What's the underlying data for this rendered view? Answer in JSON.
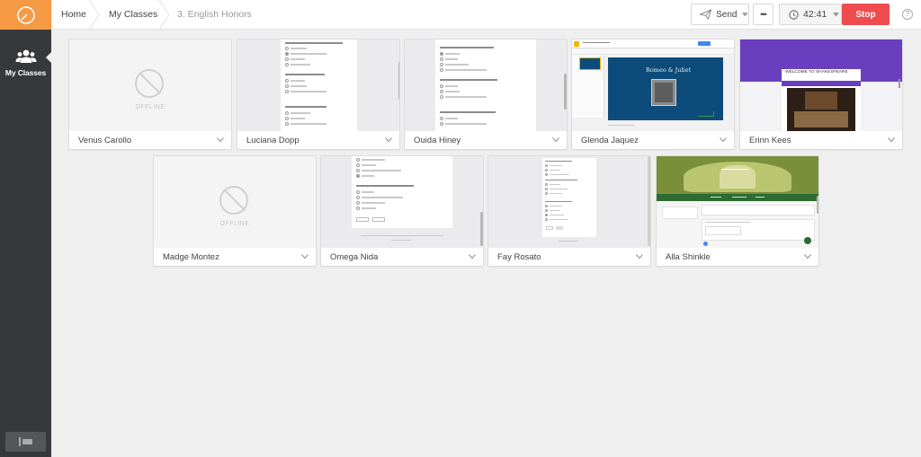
{
  "sidebar": {
    "my_classes_label": "My Classes"
  },
  "header": {
    "breadcrumb": [
      "Home",
      "My Classes",
      "3. English Honors"
    ],
    "send_label": "Send",
    "more_label": "•••",
    "timer": "42:41",
    "stop_label": "Stop",
    "help_label": "?"
  },
  "students": [
    {
      "name": "Venus Carollo",
      "status": "offline"
    },
    {
      "name": "Luciana Dopp",
      "status": "quiz"
    },
    {
      "name": "Ouida Hiney",
      "status": "quiz"
    },
    {
      "name": "Glenda Jaquez",
      "status": "slides"
    },
    {
      "name": "Erinn Kees",
      "status": "site"
    },
    {
      "name": "Madge Montez",
      "status": "offline"
    },
    {
      "name": "Omega Nida",
      "status": "quiz"
    },
    {
      "name": "Fay Rosato",
      "status": "form"
    },
    {
      "name": "Alla Shinkle",
      "status": "classroom"
    }
  ],
  "thumb_text": {
    "offline": "OFFLINE",
    "slides_title": "Romeo & Juliet",
    "site_banner": "WELCOME TO SHAKESPEARE"
  },
  "colors": {
    "accent_orange": "#f79a45",
    "stop_red": "#ef4c4f",
    "sidebar": "#37383c",
    "slides_blue": "#0d4c7a",
    "site_purple": "#6a3fbf",
    "classroom_green": "#2e6b33"
  }
}
